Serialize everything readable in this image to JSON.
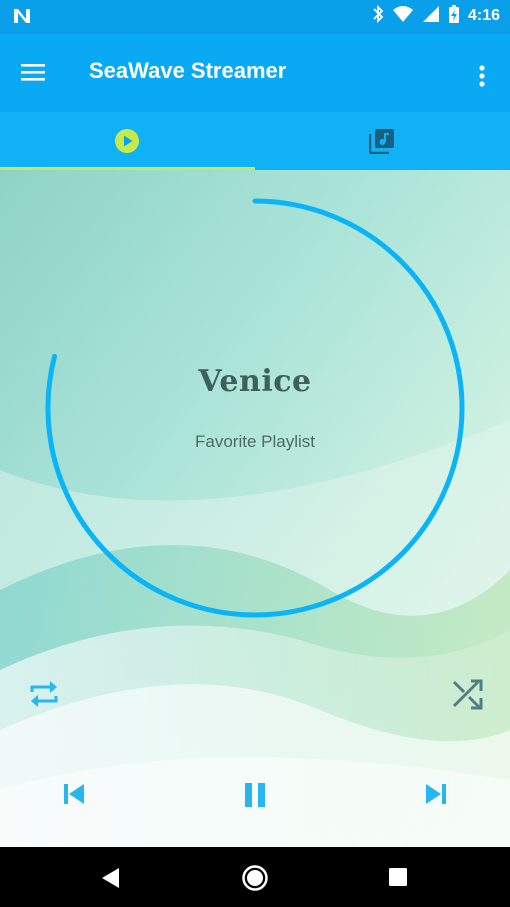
{
  "status_bar": {
    "time": "4:16",
    "notification_icon": "n-notification-icon",
    "icons": [
      "bluetooth-icon",
      "wifi-icon",
      "cell-signal-icon",
      "battery-charging-icon"
    ]
  },
  "toolbar": {
    "title": "SeaWave Streamer",
    "menu_icon": "hamburger-menu-icon",
    "more_icon": "more-vert-icon"
  },
  "tabs": [
    {
      "icon": "play-circle-icon",
      "active": true
    },
    {
      "icon": "library-music-icon",
      "active": false
    }
  ],
  "now_playing": {
    "title": "Venice",
    "subtitle": "Favorite Playlist",
    "progress_fraction": 0.79
  },
  "controls": {
    "repeat_icon": "repeat-icon",
    "shuffle_icon": "shuffle-icon",
    "previous_icon": "skip-previous-icon",
    "pause_icon": "pause-icon",
    "next_icon": "skip-next-icon"
  },
  "colors": {
    "primary": "#0aa9f4",
    "status_bar": "#0a9fe9",
    "tab_bar": "#11b2f5",
    "tab_indicator": "#c7ea4a",
    "progress_ring": "#0ab4f6",
    "control_icon": "#27b7ee",
    "nav_bar": "#000000"
  },
  "nav_bar": {
    "icons": [
      "back-icon",
      "home-icon",
      "recents-icon"
    ]
  }
}
